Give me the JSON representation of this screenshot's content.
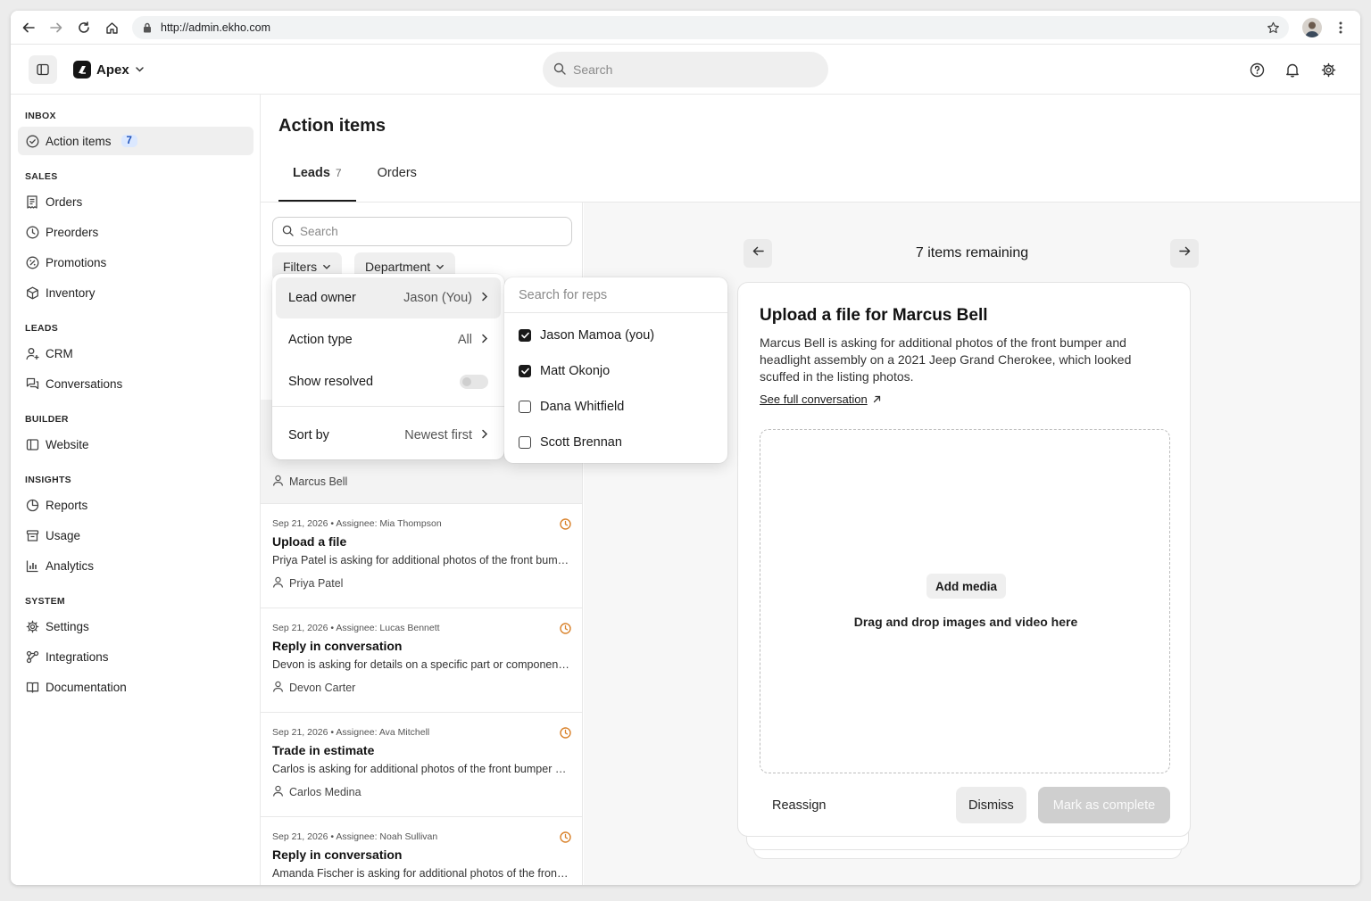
{
  "browser": {
    "url": "http://admin.ekho.com"
  },
  "header": {
    "brand": "Apex",
    "search_placeholder": "Search"
  },
  "sidebar": {
    "sections": [
      {
        "label": "INBOX",
        "items": [
          {
            "label": "Action items",
            "badge": "7",
            "icon": "check-circle-icon",
            "active": true
          }
        ]
      },
      {
        "label": "SALES",
        "items": [
          {
            "label": "Orders",
            "icon": "receipt-icon"
          },
          {
            "label": "Preorders",
            "icon": "clock-icon"
          },
          {
            "label": "Promotions",
            "icon": "tag-icon"
          },
          {
            "label": "Inventory",
            "icon": "box-icon"
          }
        ]
      },
      {
        "label": "LEADS",
        "items": [
          {
            "label": "CRM",
            "icon": "user-plus-icon"
          },
          {
            "label": "Conversations",
            "icon": "chat-icon"
          }
        ]
      },
      {
        "label": "BUILDER",
        "items": [
          {
            "label": "Website",
            "icon": "layout-icon"
          }
        ]
      },
      {
        "label": "INSIGHTS",
        "items": [
          {
            "label": "Reports",
            "icon": "pie-chart-icon"
          },
          {
            "label": "Usage",
            "icon": "archive-icon"
          },
          {
            "label": "Analytics",
            "icon": "bar-chart-icon"
          }
        ]
      },
      {
        "label": "SYSTEM",
        "items": [
          {
            "label": "Settings",
            "icon": "gear-icon"
          },
          {
            "label": "Integrations",
            "icon": "integrations-icon"
          },
          {
            "label": "Documentation",
            "icon": "book-icon"
          }
        ]
      }
    ]
  },
  "main": {
    "title": "Action items",
    "tabs": [
      {
        "label": "Leads",
        "count": "7",
        "active": true
      },
      {
        "label": "Orders",
        "count": ""
      }
    ],
    "list": {
      "search_placeholder": "Search",
      "filters_label": "Filters",
      "department_label": "Department",
      "items": [
        {
          "meta": "",
          "title": "",
          "desc": "",
          "person": "Marcus Bell"
        },
        {
          "meta": "Sep 21, 2026 • Assignee: Mia Thompson",
          "title": "Upload a file",
          "desc": "Priya Patel is asking for additional photos of the front bumper and headlight assembly",
          "person": "Priya Patel"
        },
        {
          "meta": "Sep 21, 2026 • Assignee: Lucas Bennett",
          "title": "Reply in conversation",
          "desc": "Devon is asking for details on a specific part or component for his vehicle",
          "person": "Devon Carter"
        },
        {
          "meta": "Sep 21, 2026 • Assignee: Ava Mitchell",
          "title": "Trade in estimate",
          "desc": "Carlos is asking for additional photos of the front bumper and headlight assembly",
          "person": "Carlos Medina"
        },
        {
          "meta": "Sep 21, 2026 • Assignee: Noah Sullivan",
          "title": "Reply in conversation",
          "desc": "Amanda Fischer is asking for additional photos of the front bumper and headlight",
          "person": ""
        }
      ]
    },
    "filter_menu": {
      "rows": [
        {
          "label": "Lead owner",
          "value": "Jason (You)"
        },
        {
          "label": "Action type",
          "value": "All"
        },
        {
          "label": "Show resolved",
          "value": ""
        },
        {
          "label": "Sort by",
          "value": "Newest first"
        }
      ]
    },
    "rep_menu": {
      "search_placeholder": "Search for reps",
      "reps": [
        {
          "name": "Jason Mamoa (you)",
          "checked": true
        },
        {
          "name": "Matt Okonjo",
          "checked": true
        },
        {
          "name": "Dana Whitfield",
          "checked": false
        },
        {
          "name": "Scott Brennan",
          "checked": false
        }
      ]
    },
    "detail": {
      "remaining": "7 items remaining",
      "title": "Upload a file for Marcus Bell",
      "body": "Marcus Bell is asking for additional photos of the front bumper and headlight assembly on a 2021 Jeep Grand Cherokee, which looked scuffed in the listing photos.",
      "link": "See full conversation",
      "add_media": "Add media",
      "drop_text": "Drag and drop images and video here",
      "reassign": "Reassign",
      "dismiss": "Dismiss",
      "complete": "Mark as complete"
    }
  },
  "colors": {
    "badge_bg": "#dbe8ff",
    "badge_text": "#1c4fb8",
    "clock_accent": "#d9822b"
  }
}
